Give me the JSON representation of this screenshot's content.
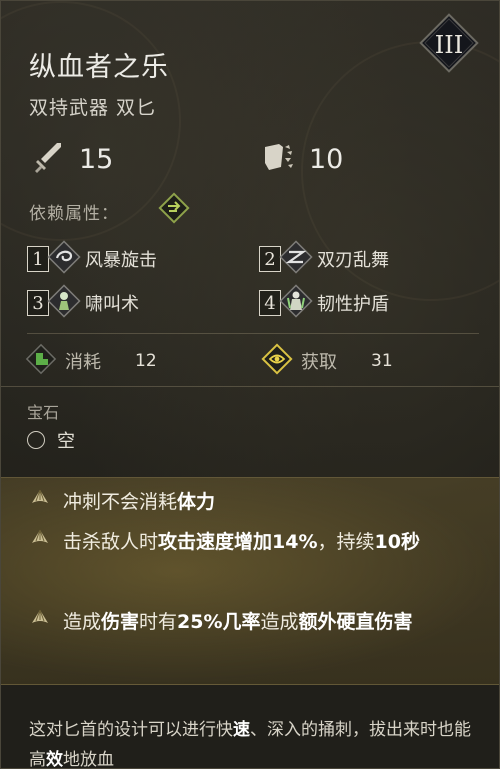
{
  "item": {
    "tier": "III",
    "name": "纵血者之乐",
    "type": "双持武器 双匕"
  },
  "stats": {
    "attack": "15",
    "block": "10"
  },
  "dependency": {
    "label": "依赖属性："
  },
  "skills": [
    {
      "num": "1",
      "name": "风暴旋击",
      "icon": "storm-swirl-icon"
    },
    {
      "num": "2",
      "name": "双刃乱舞",
      "icon": "twin-blade-icon"
    },
    {
      "num": "3",
      "name": "啸叫术",
      "icon": "howl-icon"
    },
    {
      "num": "4",
      "name": "韧性护盾",
      "icon": "tenacity-shield-icon"
    }
  ],
  "cost": {
    "label": "消耗",
    "value": "12"
  },
  "gain": {
    "label": "获取",
    "value": "31"
  },
  "gems": {
    "title": "宝石",
    "slot": "空"
  },
  "perks": [
    {
      "segments": [
        {
          "t": "冲刺不会消耗",
          "b": false
        },
        {
          "t": "体力",
          "b": true
        }
      ]
    },
    {
      "segments": [
        {
          "t": "击杀敌人时",
          "b": false
        },
        {
          "t": "攻击速度增加",
          "b": true
        },
        {
          "t": "14%",
          "b": true
        },
        {
          "t": "，持续",
          "b": false
        },
        {
          "t": "10秒",
          "b": true
        }
      ]
    },
    {
      "segments": [
        {
          "t": "造成",
          "b": false
        },
        {
          "t": "伤害",
          "b": true
        },
        {
          "t": "时有",
          "b": false
        },
        {
          "t": "25%几率",
          "b": true
        },
        {
          "t": "造成",
          "b": false
        },
        {
          "t": "额外硬直伤害",
          "b": true
        }
      ]
    }
  ],
  "flavor": {
    "segments": [
      {
        "t": "这对匕首的设计可以进行快",
        "b": false
      },
      {
        "t": "速",
        "b": true
      },
      {
        "t": "、深入的捅刺，拔出来时也能高",
        "b": false
      },
      {
        "t": "效",
        "b": true
      },
      {
        "t": "地放血",
        "b": false
      }
    ]
  },
  "colors": {
    "accent_gold": "#d9c243",
    "perk_bg": "#5f522c",
    "text": "#e9e6de"
  }
}
